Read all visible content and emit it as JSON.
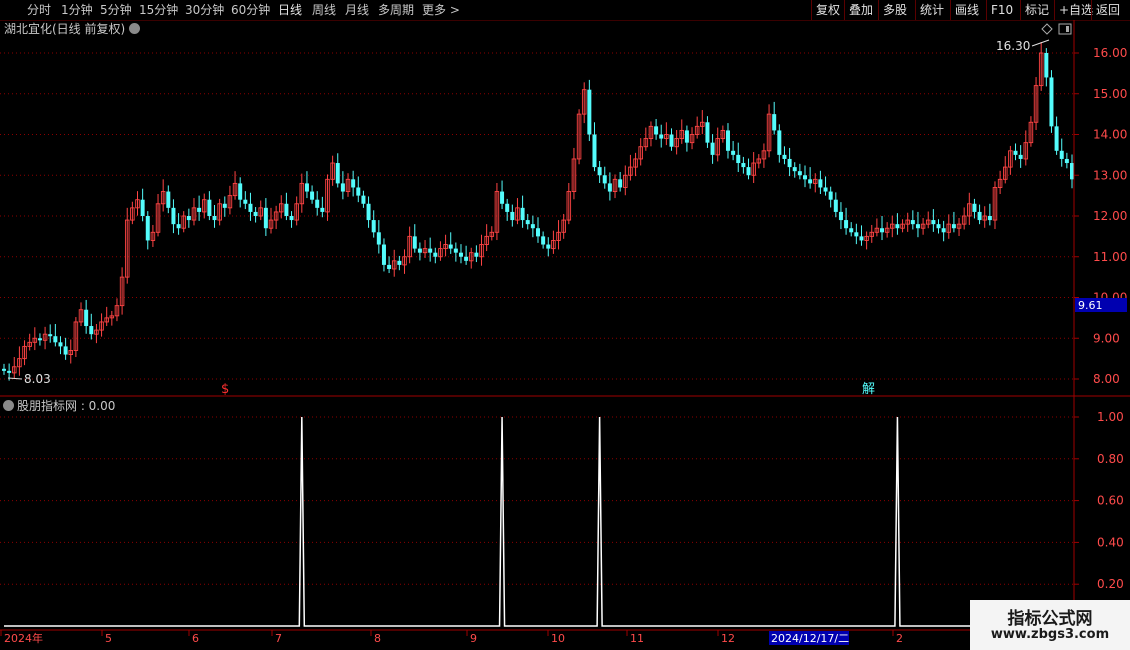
{
  "toolbar": {
    "periods": [
      "分时",
      "1分钟",
      "5分钟",
      "15分钟",
      "30分钟",
      "60分钟",
      "日线",
      "周线",
      "月线",
      "多周期",
      "更多 >"
    ],
    "active": "日线",
    "right": [
      "复权",
      "叠加",
      "多股",
      "统计",
      "画线",
      "F10",
      "标记",
      "+自选",
      "返回"
    ]
  },
  "main": {
    "title": "湖北宜化(日线 前复权)",
    "high_label": "16.30",
    "low_label": "8.03",
    "price_tag": "9.61",
    "marker_left": "$",
    "marker_right": "解"
  },
  "indicator": {
    "title": "股朋指标网 : 0.00"
  },
  "watermark": {
    "line1": "指标公式网",
    "line2": "www.zbgs3.com"
  },
  "colors": {
    "up": "#ff4444",
    "down": "#54fcfc",
    "grid": "#8b0000",
    "axis": "#a00000",
    "line": "#ffffff",
    "tag_bg": "#0000b0"
  },
  "xaxis": {
    "labels": [
      "2024年",
      "5",
      "6",
      "7",
      "8",
      "9",
      "10",
      "11",
      "12",
      "2024/12/17/二",
      "2"
    ]
  },
  "chart_data": [
    {
      "type": "candlestick",
      "name": "湖北宜化(日线 前复权)",
      "yticks": [
        8.0,
        9.0,
        10.0,
        11.0,
        12.0,
        13.0,
        14.0,
        15.0,
        16.0
      ],
      "ylim": [
        7.7,
        16.6
      ],
      "key_points": {
        "low": 8.03,
        "high": 16.3,
        "last": 9.61
      },
      "closes": [
        8.2,
        8.15,
        8.3,
        8.5,
        8.8,
        8.9,
        9.0,
        8.95,
        9.1,
        9.05,
        8.9,
        8.8,
        8.6,
        8.7,
        9.4,
        9.7,
        9.3,
        9.1,
        9.2,
        9.4,
        9.5,
        9.55,
        9.8,
        10.5,
        11.9,
        12.2,
        12.4,
        12.0,
        11.4,
        11.6,
        12.3,
        12.6,
        12.2,
        11.8,
        11.7,
        12.0,
        11.9,
        12.2,
        12.1,
        12.4,
        12.0,
        11.9,
        12.3,
        12.2,
        12.5,
        12.8,
        12.4,
        12.3,
        12.1,
        12.0,
        12.2,
        11.7,
        11.9,
        12.1,
        12.3,
        12.0,
        11.9,
        12.3,
        12.8,
        12.6,
        12.4,
        12.2,
        12.1,
        12.9,
        13.3,
        12.8,
        12.6,
        12.9,
        12.7,
        12.5,
        12.3,
        11.9,
        11.6,
        11.3,
        10.8,
        10.7,
        10.9,
        10.8,
        11.0,
        11.5,
        11.2,
        11.1,
        11.2,
        11.1,
        11.0,
        11.2,
        11.3,
        11.2,
        11.1,
        11.0,
        10.9,
        11.1,
        11.0,
        11.3,
        11.5,
        11.6,
        12.6,
        12.3,
        12.1,
        11.9,
        12.2,
        11.9,
        11.8,
        11.7,
        11.5,
        11.3,
        11.2,
        11.4,
        11.6,
        11.9,
        12.6,
        13.4,
        14.5,
        15.1,
        14.0,
        13.2,
        13.0,
        12.8,
        12.6,
        12.9,
        12.7,
        13.0,
        13.2,
        13.4,
        13.7,
        13.9,
        14.2,
        14.0,
        13.9,
        14.0,
        13.7,
        13.9,
        14.1,
        13.8,
        14.0,
        14.2,
        14.3,
        13.8,
        13.5,
        13.9,
        14.1,
        13.6,
        13.5,
        13.3,
        13.2,
        13.0,
        13.3,
        13.4,
        13.6,
        14.5,
        14.1,
        13.5,
        13.4,
        13.2,
        13.1,
        13.0,
        12.9,
        12.8,
        12.9,
        12.7,
        12.6,
        12.4,
        12.1,
        11.9,
        11.7,
        11.6,
        11.5,
        11.4,
        11.5,
        11.6,
        11.7,
        11.6,
        11.7,
        11.8,
        11.7,
        11.8,
        11.9,
        11.8,
        11.7,
        11.8,
        11.9,
        11.8,
        11.7,
        11.6,
        11.8,
        11.7,
        11.8,
        12.0,
        12.3,
        12.1,
        11.9,
        12.0,
        11.9,
        12.7,
        12.9,
        13.2,
        13.6,
        13.5,
        13.4,
        13.8,
        14.3,
        15.2,
        16.0,
        15.4,
        14.2,
        13.6,
        13.4,
        13.3,
        12.9
      ]
    },
    {
      "type": "line",
      "name": "股朋指标网",
      "value": 0.0,
      "yticks": [
        0.2,
        0.4,
        0.6,
        0.8,
        1.0
      ],
      "ylim": [
        0,
        1.06
      ],
      "spikes_at_index": [
        58,
        97,
        116,
        174
      ],
      "series": [
        {
          "name": "股朋指标网",
          "values_note": "0 except 1.00 at spike indices"
        }
      ]
    }
  ]
}
